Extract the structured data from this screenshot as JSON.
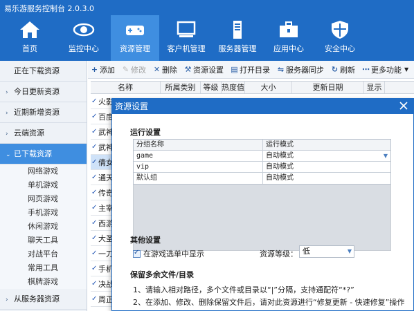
{
  "app": {
    "title": "易乐游服务控制台 2.0.3.0"
  },
  "nav": [
    {
      "label": "首页",
      "icon": "home-icon"
    },
    {
      "label": "监控中心",
      "icon": "eye-icon"
    },
    {
      "label": "资源管理",
      "icon": "gamepad-icon",
      "active": true
    },
    {
      "label": "客户机管理",
      "icon": "monitor-icon"
    },
    {
      "label": "服务器管理",
      "icon": "server-icon"
    },
    {
      "label": "应用中心",
      "icon": "toolbox-icon"
    },
    {
      "label": "安全中心",
      "icon": "shield-icon"
    }
  ],
  "sidebar": {
    "items": [
      {
        "label": "正在下载资源"
      },
      {
        "label": "今日更新资源"
      },
      {
        "label": "近期新增资源"
      },
      {
        "label": "云端资源"
      },
      {
        "label": "已下载资源"
      },
      {
        "label": "从服务器资源"
      }
    ],
    "subitems": [
      "网络游戏",
      "单机游戏",
      "网页游戏",
      "手机游戏",
      "休闲游戏",
      "聊天工具",
      "对战平台",
      "常用工具",
      "棋牌游戏"
    ]
  },
  "toolbar": {
    "add": "添加",
    "edit": "修改",
    "delete": "删除",
    "settings": "资源设置",
    "open_dir": "打开目录",
    "sync": "服务器同步",
    "refresh": "刷新",
    "more": "更多功能"
  },
  "grid": {
    "columns": [
      "名称",
      "所属类别",
      "等级",
      "热度值",
      "大小",
      "更新日期",
      "显示"
    ],
    "rows": [
      "火影",
      "百度",
      "武神",
      "武神",
      "倩女",
      "通天",
      "传奇",
      "主宰",
      "西游",
      "大圣",
      "一刀",
      "手机",
      "决战",
      "周正"
    ]
  },
  "dialog": {
    "title": "资源设置",
    "run_section": "运行设置",
    "run_table": {
      "headers": [
        "分组名称",
        "运行模式"
      ],
      "rows": [
        {
          "group": "game",
          "mode": "自动模式"
        },
        {
          "group": "vip",
          "mode": "自动模式"
        },
        {
          "group": "默认组",
          "mode": "自动模式"
        }
      ]
    },
    "other_section": "其他设置",
    "show_in_menu": "在游戏选单中显示",
    "level_label": "资源等级：",
    "level_value": "低",
    "keep_section": "保留多余文件/目录",
    "hint1": "1、请输入相对路径，多个文件或目录以“|”分隔，支持通配符“*?”",
    "hint2": "2、在添加、修改、删除保留文件后，请对此资源进行“修复更新 - 快速修复”操作"
  }
}
